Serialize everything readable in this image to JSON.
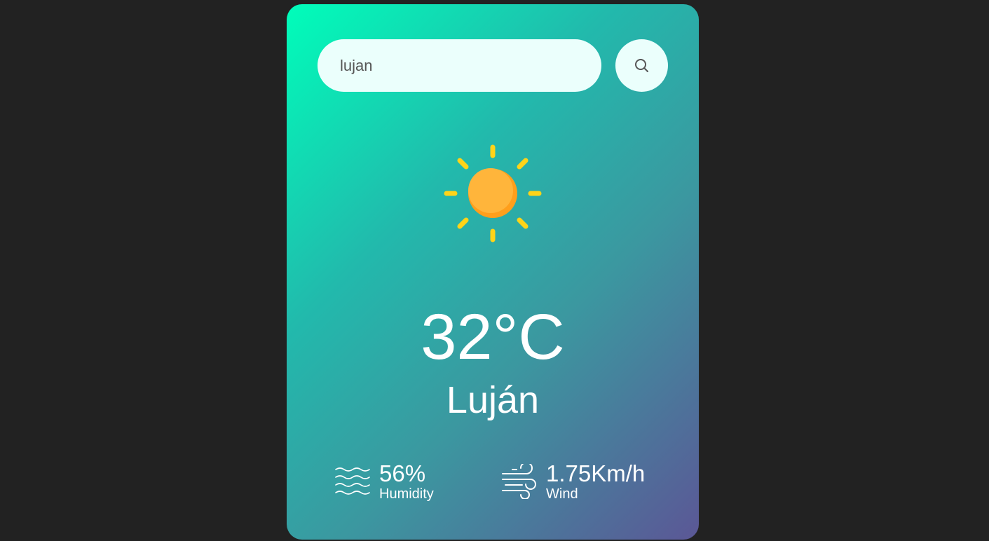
{
  "search": {
    "value": "lujan",
    "button_icon": "search-icon"
  },
  "weather": {
    "icon": "sun-icon",
    "temperature": "32°C",
    "city": "Luján"
  },
  "details": {
    "humidity": {
      "value": "56%",
      "label": "Humidity",
      "icon": "humidity-icon"
    },
    "wind": {
      "value": "1.75Km/h",
      "label": "Wind",
      "icon": "wind-icon"
    }
  },
  "colors": {
    "background": "#222222",
    "card_gradient_start": "#00feba",
    "card_gradient_end": "#5b5796",
    "input_background": "#ebfffc",
    "sun_rays": "#ffd418",
    "sun_body": "#ffb53b"
  }
}
